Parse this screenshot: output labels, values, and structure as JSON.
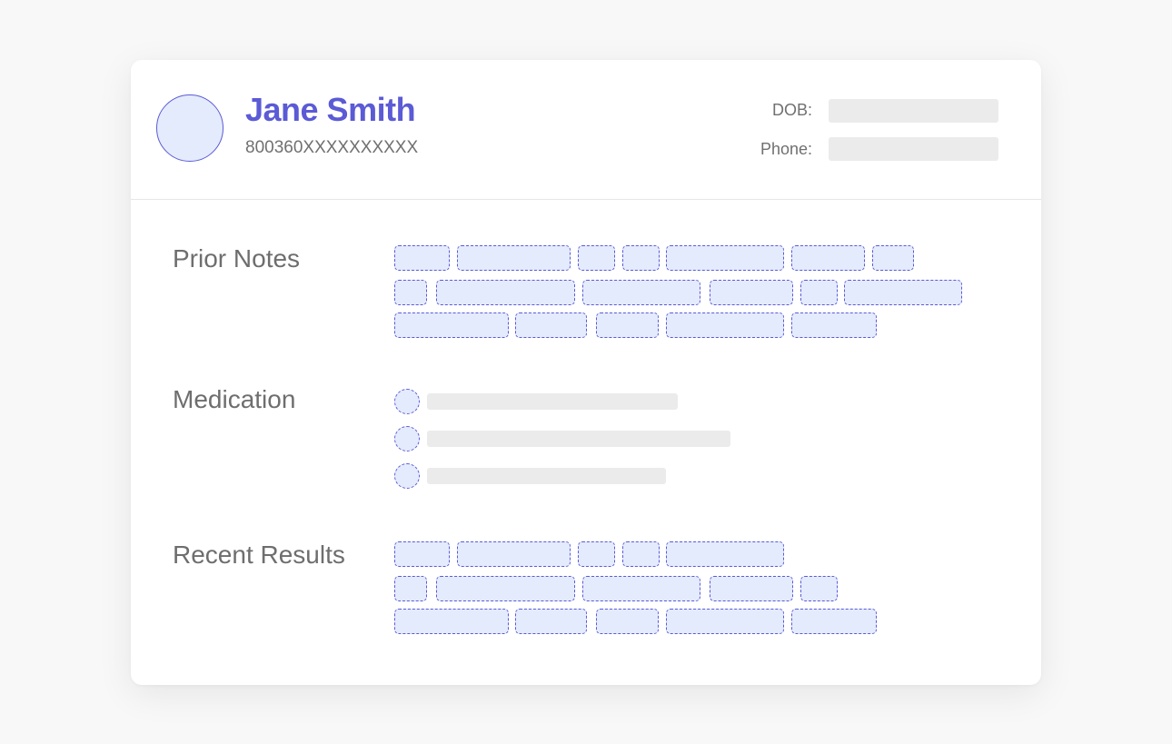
{
  "patient": {
    "name": "Jane Smith",
    "id_number": "800360XXXXXXXXXX"
  },
  "details": {
    "dob_label": "DOB:",
    "phone_label": "Phone:"
  },
  "sections": {
    "prior_notes": "Prior Notes",
    "medication": "Medication",
    "recent_results": "Recent Results"
  },
  "colors": {
    "accent": "#5b5bd6",
    "placeholder_fill": "#e4ebfd",
    "placeholder_gray": "#ebebeb",
    "label_text": "#707070"
  }
}
